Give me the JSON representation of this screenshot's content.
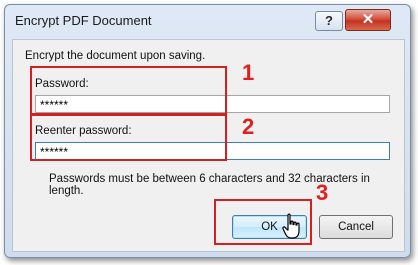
{
  "window": {
    "title": "Encrypt PDF Document",
    "help_label": "?",
    "close_label": "✕"
  },
  "dialog": {
    "intro": "Encrypt the document upon saving.",
    "password_label": "Password:",
    "password_value": "******",
    "reenter_label": "Reenter password:",
    "reenter_value": "******",
    "hint": "Passwords must be between 6 characters and 32 characters in length.",
    "ok_label": "OK",
    "cancel_label": "Cancel"
  },
  "annotations": {
    "step1": "1",
    "step2": "2",
    "step3": "3",
    "color": "#d32020"
  },
  "icons": {
    "cursor": "pointer-hand-icon"
  }
}
